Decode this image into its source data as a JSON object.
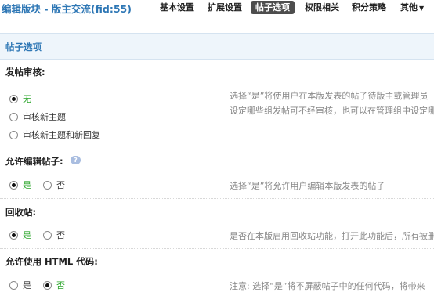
{
  "header": {
    "title": "编辑版块 - 版主交流(fid:55)",
    "tabs": [
      {
        "label": "基本设置"
      },
      {
        "label": "扩展设置"
      },
      {
        "label": "帖子选项"
      },
      {
        "label": "权限相关"
      },
      {
        "label": "积分策略"
      },
      {
        "label": "其他"
      }
    ],
    "active_tab": "帖子选项"
  },
  "section": {
    "title": "帖子选项"
  },
  "settings": {
    "moderation": {
      "label": "发帖审核:",
      "options": [
        "无",
        "审核新主题",
        "审核新主题和新回复"
      ],
      "selected": "无",
      "desc_lines": [
        "选择“是”将使用户在本版发表的帖子待版主或管理员",
        "设定哪些组发帖可不经审核，也可以在管理组中设定哪"
      ]
    },
    "allow_edit": {
      "label": "允许编辑帖子:",
      "options": [
        "是",
        "否"
      ],
      "selected": "是",
      "desc": "选择“是”将允许用户编辑本版发表的帖子"
    },
    "recycle": {
      "label": "回收站:",
      "options": [
        "是",
        "否"
      ],
      "selected": "是",
      "desc": "是否在本版启用回收站功能，打开此功能后，所有被删"
    },
    "html_code": {
      "label": "允许使用 HTML 代码:",
      "options": [
        "是",
        "否"
      ],
      "selected": "否",
      "desc": "注意: 选择“是”将不屏蔽帖子中的任何代码，将带来"
    }
  },
  "colors": {
    "accent": "#2e77b5",
    "active_tab_bg": "#4d4d4d",
    "selected_option": "#2aa52a"
  }
}
